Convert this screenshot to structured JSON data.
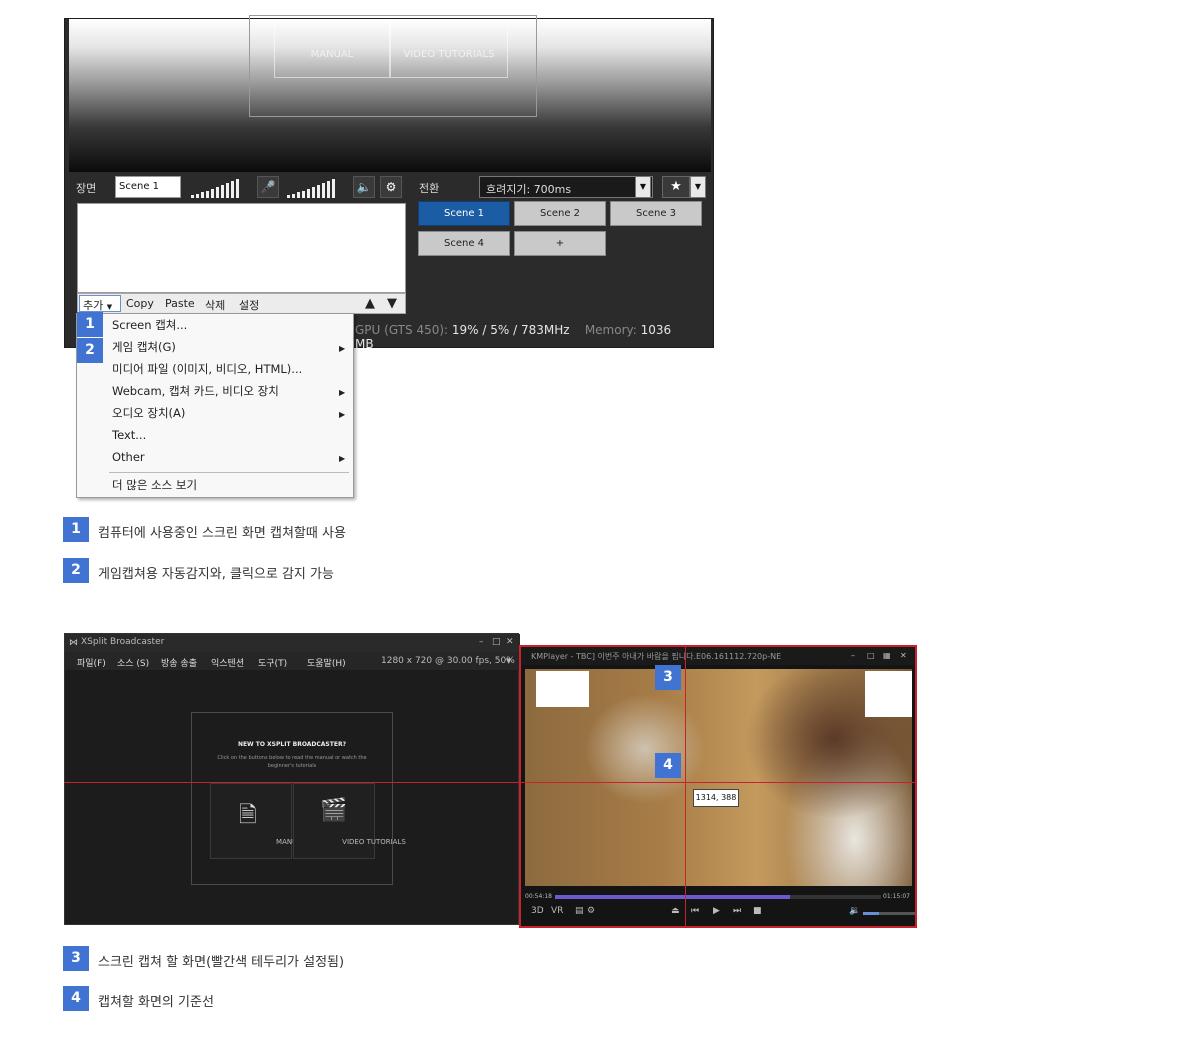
{
  "top_shot": {
    "welcome_tiles": [
      "MANUAL",
      "VIDEO TUTORIALS"
    ],
    "scene_label": "장면",
    "scene_name": "Scene 1",
    "transition_label": "전환",
    "transition_value": "흐려지기: 700ms",
    "scenes": [
      "Scene 1",
      "Scene 2",
      "Scene 3",
      "Scene 4",
      "+"
    ],
    "toolbar": {
      "add": "추가",
      "copy": "Copy",
      "paste": "Paste",
      "delete": "삭제",
      "settings": "설정"
    },
    "status": {
      "gpu_label": "GPU (GTS 450):",
      "gpu_value": "19% / 5% / 783MHz",
      "memory_label": "Memory:",
      "memory_value": "1036 MB"
    }
  },
  "context_menu": [
    {
      "label": "Screen 캡쳐...",
      "submenu": false
    },
    {
      "label": "게임 캡쳐(G)",
      "submenu": true
    },
    {
      "label": "미디어 파일 (이미지, 비디오, HTML)...",
      "submenu": false
    },
    {
      "label": "Webcam, 캡쳐 카드, 비디오 장치",
      "submenu": true
    },
    {
      "label": "오디오 장치(A)",
      "submenu": true
    },
    {
      "label": "Text...",
      "submenu": false
    },
    {
      "label": "Other",
      "submenu": true
    },
    {
      "label": "더 많은 소스 보기",
      "submenu": false
    }
  ],
  "badges": [
    "1",
    "2",
    "3",
    "4"
  ],
  "captions": [
    "컴퓨터에 사용중인 스크린 화면 캡쳐할때 사용",
    "게임캡쳐용 자동감지와, 클릭으로 감지 가능",
    "스크린 캡쳐 할 화면(빨간색 테두리가 설정됨)",
    "캡쳐할 화면의 기준선"
  ],
  "xsplit": {
    "title": "XSplit Broadcaster",
    "menus": [
      "파일(F)",
      "소스 (S)",
      "방송 송출",
      "익스텐션",
      "도구(T)",
      "도움말(H)"
    ],
    "resolution": "1280 x 720 @ 30.00 fps, 50%",
    "new_title": "NEW TO XSPLIT BROADCASTER?",
    "new_sub": "Click on the buttons below to read the manual or watch the beginner's tutorials",
    "tiles": [
      "MANUAL",
      "VIDEO TUTORIALS"
    ]
  },
  "kmplayer": {
    "title": "KMPlayer - TBC] 이번주 아내가 바람을 핍니다.E06.161112.720p-NE",
    "time_current": "00:54:18",
    "time_total": "01:15:07",
    "progress": 0.72,
    "volume": 0.3,
    "coord": "1314, 388"
  }
}
